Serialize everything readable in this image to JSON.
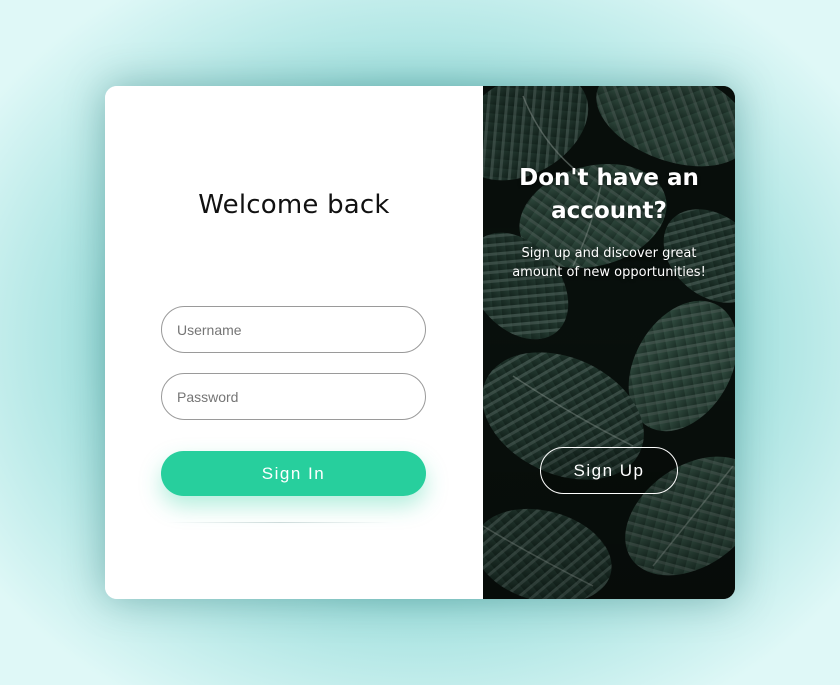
{
  "login": {
    "title": "Welcome back",
    "username_placeholder": "Username",
    "password_placeholder": "Password",
    "sign_in_label": "Sign In"
  },
  "signup_panel": {
    "title": "Don't have an account?",
    "description": "Sign up and discover great amount of new opportunities!",
    "sign_up_label": "Sign Up"
  },
  "colors": {
    "accent": "#27cf9d",
    "background": "#5dbcb8",
    "panel_dark": "#0d1511"
  }
}
